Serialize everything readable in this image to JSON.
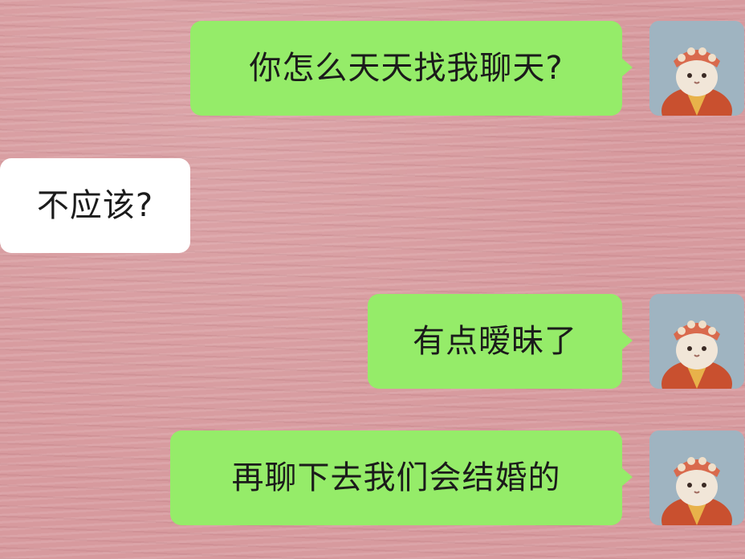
{
  "messages": [
    {
      "side": "sent",
      "text": "你怎么天天找我聊天?"
    },
    {
      "side": "received",
      "text": "不应该?"
    },
    {
      "side": "sent",
      "text": "有点暧昧了"
    },
    {
      "side": "sent",
      "text": "再聊下去我们会结婚的"
    }
  ],
  "avatar": {
    "icon": "cat-monk-avatar-icon"
  },
  "colors": {
    "sent_bubble": "#95ec69",
    "received_bubble": "#ffffff",
    "background": "#d79a9e",
    "text": "#1b1b1b"
  }
}
